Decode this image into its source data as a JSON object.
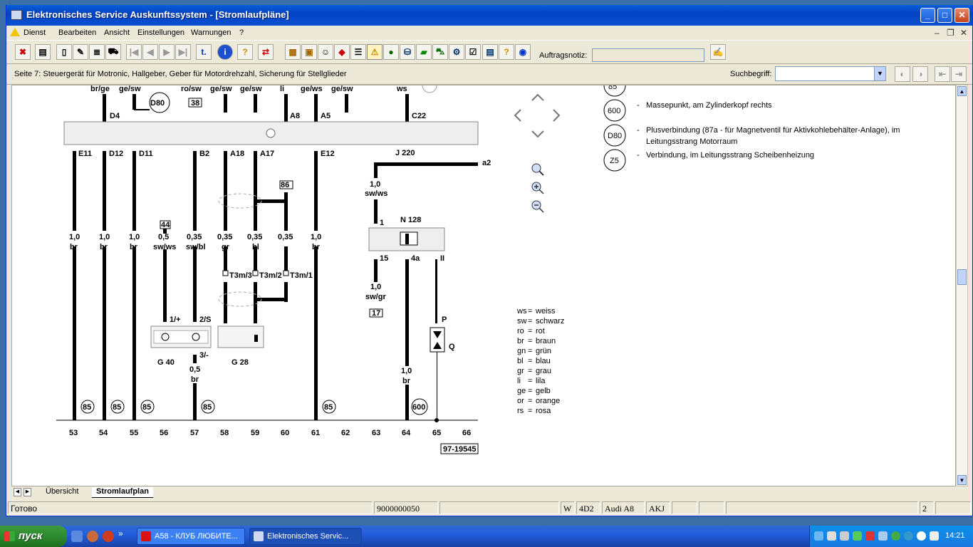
{
  "window": {
    "title": "Elektronisches Service Auskunftssystem - [Stromlaufpläne]",
    "controls": {
      "minimize": "_",
      "maximize": "□",
      "close": "✕"
    }
  },
  "menu": {
    "items": [
      "Dienst",
      "Bearbeiten",
      "Ansicht",
      "Einstellungen",
      "Warnungen",
      "?"
    ],
    "mdi": {
      "minimize": "–",
      "restore": "❐",
      "close": "✕"
    }
  },
  "toolbar": {
    "notiz_label": "Auftragsnotiz:",
    "notiz_value": "",
    "glyphs": {
      "first": "|◀",
      "prev": "◀",
      "next": "▶",
      "last": "▶|",
      "jump": "t.",
      "info": "i",
      "help": "?",
      "swap": "⇄",
      "warning": "⚠"
    }
  },
  "infobar": {
    "page_info": "Seite 7: Steuergerät für Motronic, Hallgeber, Geber für Motordrehzahl, Sicherung für Stellglieder",
    "such_label": "Suchbegriff:",
    "such_value": ""
  },
  "diagram": {
    "top_labels": [
      "br/ge",
      "ge/sw",
      "ro/sw",
      "ge/sw",
      "ge/sw",
      "li",
      "ge/ws",
      "ge/sw",
      "ws"
    ],
    "top_pins": [
      "D4",
      "A8",
      "A5",
      "C22"
    ],
    "d80_label": "D80",
    "box38": "38",
    "pins": [
      "E11",
      "D12",
      "D11",
      "B2",
      "A18",
      "A17",
      "E12"
    ],
    "gauges": [
      "1,0",
      "1,0",
      "1,0",
      "0,5",
      "0,35",
      "0,35",
      "0,35",
      "0,35",
      "1,0"
    ],
    "colors": [
      "br",
      "br",
      "br",
      "sw/ws",
      "sw/bl",
      "gr",
      "bl",
      "",
      "br"
    ],
    "box44": "44",
    "box86": "86",
    "t3m": [
      "T3m/3",
      "T3m/2",
      "T3m/1"
    ],
    "j220": "J 220",
    "a2": "a2",
    "n128": "N 128",
    "n128_upper": {
      "gauge": "1,0",
      "color": "sw/ws",
      "pin": "1"
    },
    "n128_lower": {
      "pin15": "15",
      "pin4a": "4a",
      "pinII": "II"
    },
    "wire17": {
      "gauge": "1,0",
      "color": "sw/gr",
      "box": "17"
    },
    "wire64": {
      "gauge": "1,0",
      "color": "br"
    },
    "pq": {
      "p": "P",
      "q": "Q"
    },
    "g40": {
      "label": "G 40",
      "pin1": "1/+",
      "pin2": "2/S",
      "pin3": "3/-",
      "gauge": "0,5",
      "color": "br"
    },
    "g28": "G 28",
    "ground": [
      "85",
      "85",
      "85",
      "85",
      "85",
      "600"
    ],
    "columns": [
      "53",
      "54",
      "55",
      "56",
      "57",
      "58",
      "59",
      "60",
      "61",
      "62",
      "63",
      "64",
      "65",
      "66"
    ],
    "doc_number": "97-19545"
  },
  "navigation": {
    "up": "up-arrow",
    "down": "down-arrow",
    "left": "left-arrow",
    "right": "right-arrow"
  },
  "legend_points": [
    {
      "id": "600",
      "text": "Massepunkt, am Zylinderkopf rechts"
    },
    {
      "id": "D80",
      "text": "Plusverbindung (87a - für Magnetventil für Aktivkohlebehälter-Anlage), im",
      "text2": "Leitungsstrang Motorraum"
    },
    {
      "id": "Z5",
      "text": "Verbindung, im Leitungsstrang Scheibenheizung"
    }
  ],
  "legend_top_partial": "85",
  "color_legend": [
    {
      "code": "ws",
      "name": "weiss"
    },
    {
      "code": "sw",
      "name": "schwarz"
    },
    {
      "code": "ro",
      "name": "rot"
    },
    {
      "code": "br",
      "name": "braun"
    },
    {
      "code": "gn",
      "name": "grün"
    },
    {
      "code": "bl",
      "name": "blau"
    },
    {
      "code": "gr",
      "name": "grau"
    },
    {
      "code": "li",
      "name": "lila"
    },
    {
      "code": "ge",
      "name": "gelb"
    },
    {
      "code": "or",
      "name": "orange"
    },
    {
      "code": "rs",
      "name": "rosa"
    }
  ],
  "tabs": [
    "Übersicht",
    "Stromlaufplan"
  ],
  "status": {
    "ready": "Готово",
    "order": "9000000050",
    "w": "W",
    "code": "4D2",
    "model": "Audi A8",
    "engine": "AKJ",
    "page": "2"
  },
  "taskbar": {
    "start": "пуск",
    "tasks": [
      "А58 - КЛУБ ЛЮБИТЕ...",
      "Elektronisches Servic..."
    ],
    "more": "»",
    "clock": "14:21"
  },
  "colors": {
    "titlebar": "#0a5fd8",
    "taskbar": "#245edb",
    "start": "#2f8a2f",
    "window_bg": "#ece9d8"
  }
}
